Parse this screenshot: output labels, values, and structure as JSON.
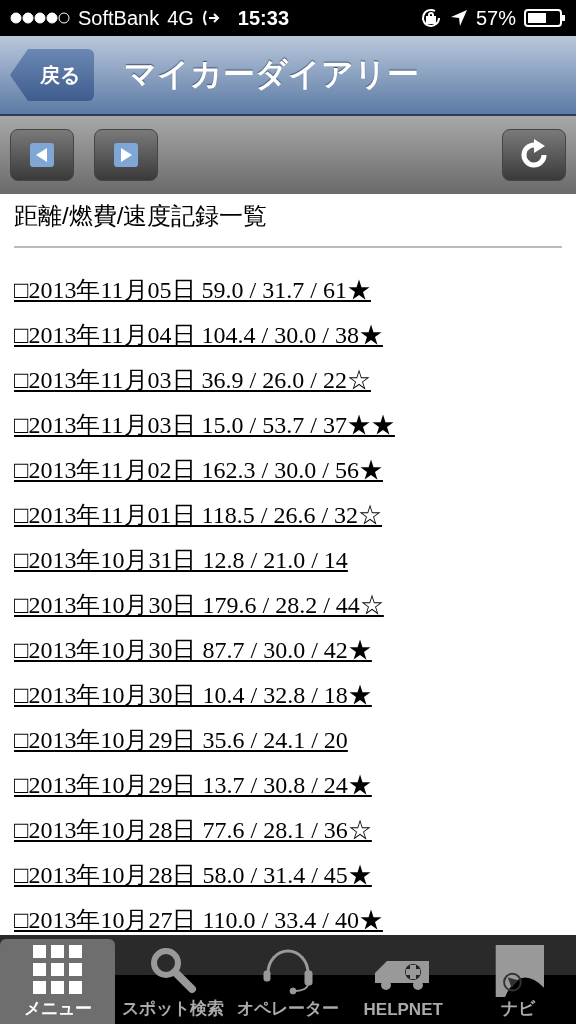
{
  "status_bar": {
    "carrier": "SoftBank",
    "network": "4G",
    "time": "15:33",
    "battery": "57%"
  },
  "nav_bar": {
    "back": "戻る",
    "title": "マイカーダイアリー"
  },
  "content": {
    "heading": "距離/燃費/速度記録一覧",
    "records": [
      "□2013年11月05日 59.0 / 31.7 / 61★",
      "□2013年11月04日 104.4 / 30.0 / 38★",
      "□2013年11月03日 36.9 / 26.0 / 22☆",
      "□2013年11月03日 15.0 / 53.7 / 37★★",
      "□2013年11月02日 162.3 / 30.0 / 56★",
      "□2013年11月01日 118.5 / 26.6 / 32☆",
      "□2013年10月31日 12.8 / 21.0 / 14",
      "□2013年10月30日 179.6 / 28.2 / 44☆",
      "□2013年10月30日 87.7 / 30.0 / 42★",
      "□2013年10月30日 10.4 / 32.8 / 18★",
      "□2013年10月29日 35.6 / 24.1 / 20",
      "□2013年10月29日 13.7 / 30.8 / 24★",
      "□2013年10月28日 77.6 / 28.1 / 36☆",
      "□2013年10月28日 58.0 / 31.4 / 45★",
      "□2013年10月27日 110.0 / 33.4 / 40★"
    ]
  },
  "tab_bar": [
    {
      "kind": "grid",
      "label": "メニュー",
      "selected": true
    },
    {
      "kind": "search",
      "label": "スポット検索",
      "selected": false
    },
    {
      "kind": "headset",
      "label": "オペレーター",
      "selected": false
    },
    {
      "kind": "ambulance",
      "label": "HELPNET",
      "selected": false
    },
    {
      "kind": "navi",
      "label": "ナビ",
      "selected": false
    }
  ]
}
